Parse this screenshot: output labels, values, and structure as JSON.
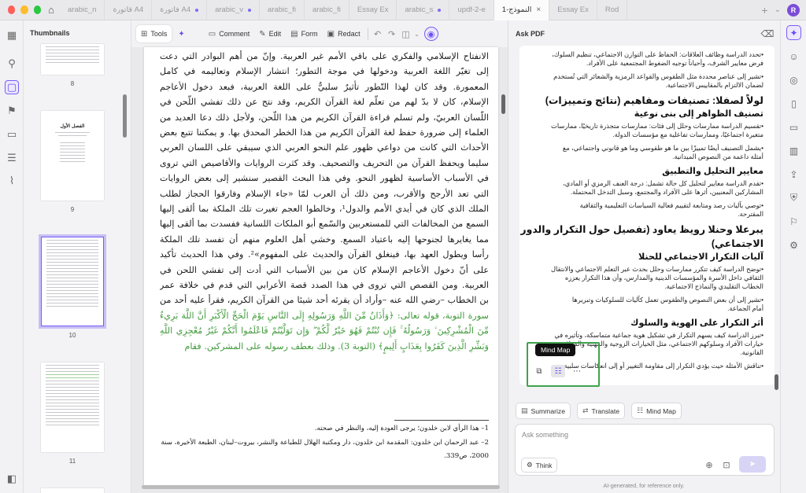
{
  "tabs": [
    {
      "label": "arabic_n",
      "dot": false
    },
    {
      "label": "قاتورة A4",
      "dot": false
    },
    {
      "label": "فاتورة A4",
      "dot": true
    },
    {
      "label": "arabic_v",
      "dot": true
    },
    {
      "label": "arabic_fi",
      "dot": false
    },
    {
      "label": "arabic_fi",
      "dot": false
    },
    {
      "label": "Essay Ex",
      "dot": false
    },
    {
      "label": "arabic_s",
      "dot": true
    },
    {
      "label": "updf-2-e",
      "dot": false
    },
    {
      "label": "النموذج-1",
      "active": true
    },
    {
      "label": "Essay Ex",
      "dot": false
    },
    {
      "label": "Rod",
      "dot": false
    }
  ],
  "user_initial": "R",
  "thumbnails": {
    "header": "Thumbnails",
    "pages": [
      "8",
      "9",
      "10",
      "11"
    ],
    "page9_title": "الفصل الأول"
  },
  "toolbar": {
    "tools": "Tools",
    "comment": "Comment",
    "edit": "Edit",
    "form": "Form",
    "redact": "Redact"
  },
  "document": {
    "lines": [
      "الانفتاح الإسلامي والفكري على باقي الأمم غير العربية. وإنّ من أهم البوادر التي دعت",
      "إلى تغيّر اللغة العربية ودخولها في موجة التطور؛ انتشار الإسلام وتعاليمه في كامل",
      "المعمورة. وقد كان لهذا التّطور تأثيرٌ سلبيٌّ على اللغة العربية، فبعد دخول الأعاجم",
      "الإسلام، كان لا بدّ لهم من تعلّم لغة القرآن الكريم، وقد نتج عن ذلك تفشي اللّحن في",
      "اللّسان العربيّ، ولم تسلم قراءة القرآن الكريم من هذا اللّحن، ولأجل ذلك دعا العديد من",
      "العلماء إلى ضرورة حفظ لغة القرآن الكريم من هذا الخطر المحدق بها. و يمكننا تتبع بعض",
      "الأحداث التي كانت من دواعي ظهور علم النحو العربي الذي سيبقي على اللسان العربي",
      "سليما ويحفظ القرآن من التحريف والتصحيف. وقد كثرت الروايات والأقاصيص التي تروى",
      "في الأسباب الأساسية لظهور النحو. وفي هذا البحث القصير سنشير إلى بعض الروايات",
      "التي تعد الأرجح والأقرب، ومن ذلك أن العرب لمّا «جاء الإسلام وفارقوا الحجاز لطلب",
      "الملك الذي كان في أيدي الأمم والدول¹، وخالطوا العجم تغيرت تلك الملكة بما ألقى إليها",
      "السمع من المخالفات التي للمستعربين والسّمع أبو الملكات اللسانية ففسدت بما ألقى إليها",
      "مما يغايرها لجنوحها إليه باعتياد السمع. وخشي أهل العلوم منهم أن تفسد تلك الملكة",
      "رأسا ويطول العهد بها، فينغلق القرآن والحديث على المفهوم»². وفي هذا الحديث تأكيد",
      "على أنّ دخول الأعاجم الإسلام كان من بين الأسباب التي أدت إلى تفشي اللحن في",
      "العربية. ومن القصص التي تروى في هذا الصدد قصة الأعرابي التي قدم في خلافة عمر",
      "بن الخطاب –رضي الله عنه –وأراد أن يقرئه أحد شيئا من القرآن الكريم، فقرأ عليه أحد من",
      "سورة التوبة، قوله تعالى: ﴿وَأَذَانٌ مِّنَ اللَّهِ وَرَسُولِهِ إِلَى النَّاسِ يَوْمَ الْحَجِّ الْأَكْبَرِ أَنَّ اللَّهَ بَرِيءٌ",
      "مِّنَ الْمُشْرِكِينَ ۙ وَرَسُولُهُ ۚ فَإِن تُبْتُمْ فَهُوَ خَيْرٌ لَّكُمْ ۖ وَإِن تَوَلَّيْتُمْ فَاعْلَمُوا أَنَّكُمْ غَيْرُ مُعْجِزِي اللَّهِ",
      "وَبَشِّرِ الَّذِينَ كَفَرُوا بِعَذَابٍ أَلِيمٍ﴾ (التوبة 3). وذلك بعطف رسوله على المشركين. فقام"
    ],
    "footnotes": [
      "1– هذا الرأي لابن خلدون؛ يرجى العودة إليه، والنظر في صحته.",
      "2– عبد الرحمان ابن خلدون: المقدمة ابن خلدون، دار ومكتبة الهلال للطباعة والنشر، بيروت–لبنان، الطبعة الأخيرة، سنة",
      "2000، ص339."
    ]
  },
  "ai_panel": {
    "title": "Ask PDF",
    "answer": [
      {
        "type": "bullet",
        "lines": [
          "•تحدد الدراسة وظائف العلاقات: الحفاظ على التوازن الاجتماعي، تنظيم السلوك،",
          "فرض معايير الشرف، وأحياناً توجيه الضغوط المجتمعية على الأفراد."
        ]
      },
      {
        "type": "bullet",
        "lines": [
          "•تشير إلى عناصر محددة مثل الطقوس والقواعد الرمزية والشعائر التي تُستخدم",
          "لضمان الالتزام بالمقاييس الاجتماعية."
        ]
      },
      {
        "type": "h2",
        "text": "لولاً لصفلا: تصنيفات ومفاهيم (نتائج وتمييزات)"
      },
      {
        "type": "h3",
        "text": "تصنيف الظواهر إلى بنى نوعية"
      },
      {
        "type": "bullet",
        "lines": [
          "•تقسيم الدراسة ممارسات وحلل إلى فئات: ممارسات متجذرة تاريخيًا، ممارسات",
          "متغيرة اجتماعيًا، وممارسات تفاعلية مع مؤسسات الدولة."
        ]
      },
      {
        "type": "bullet",
        "lines": [
          "•يشمل التصنيف أيضًا تمييزًا بين ما هو طقوسي وما هو قانوني واجتماعي، مع",
          "أمثلة داعمة من النصوص الميدانية."
        ]
      },
      {
        "type": "h3",
        "text": "معايير التحليل والتطبيق"
      },
      {
        "type": "bullet",
        "lines": [
          "•تقدم الدراسة معايير لتحليل كل حالة تشمل: درجة العنف الرمزي أو المادي،",
          "المشاركين المعنيين، أثرها على الأفراد والمجتمع، وسبل التدخل المحتملة."
        ]
      },
      {
        "type": "bullet",
        "lines": [
          "•توصي بآليات رصد ومتابعة لتقييم فعالية السياسات التعليمية والثقافية",
          "المقترحة."
        ]
      },
      {
        "type": "h2",
        "text": "يبرعلا وحنلا رويظ يعاود (تفصيل حول التكرار والدور"
      },
      {
        "type": "h2",
        "text": "الاجتماعي)"
      },
      {
        "type": "h3",
        "text": "آليات التكرار الاجتماعي للحنلا"
      },
      {
        "type": "bullet",
        "lines": [
          "•توضح الدراسة كيف تتكرر ممارسات وحلل بحدث عبر التعلم الاجتماعي والانتقال",
          "الثقافي داخل الأسرة والمؤسسات الدينية والمدارس، وأن هذا التكرار يعززه",
          "الخطاب التقليدي والنماذج الاجتماعية."
        ]
      },
      {
        "type": "bullet",
        "lines": [
          "•تشير إلى أن بعض النصوص والطقوس تعمل كآليات للسلوكيات وتبريرها",
          "أمام الجماعة."
        ]
      },
      {
        "type": "h3",
        "text": "أثر التكرار على الهوية والسلوك"
      },
      {
        "type": "bullet",
        "lines": [
          "•تبرز الدراسة كيف يسهم التكرار في تشكيل هوية جماعية متماسكة، وتأثيره في",
          "خيارات الأفراد وسلوكهم الاجتماعي، مثل الخيارات الزوجية والمهنية والمواقف",
          "القانونية."
        ]
      },
      {
        "type": "bullet",
        "lines": [
          "•تناقش الأمثلة حيث يؤدي التكرار إلى مقاومة التغيير أو إلى انعكاسات سلبية"
        ]
      }
    ],
    "tooltip": "Mind Map",
    "quick_actions": [
      "Summarize",
      "Translate",
      "Mind Map"
    ],
    "input_placeholder": "Ask something",
    "think_label": "Think",
    "disclaimer": "AI-generated, for reference only."
  }
}
